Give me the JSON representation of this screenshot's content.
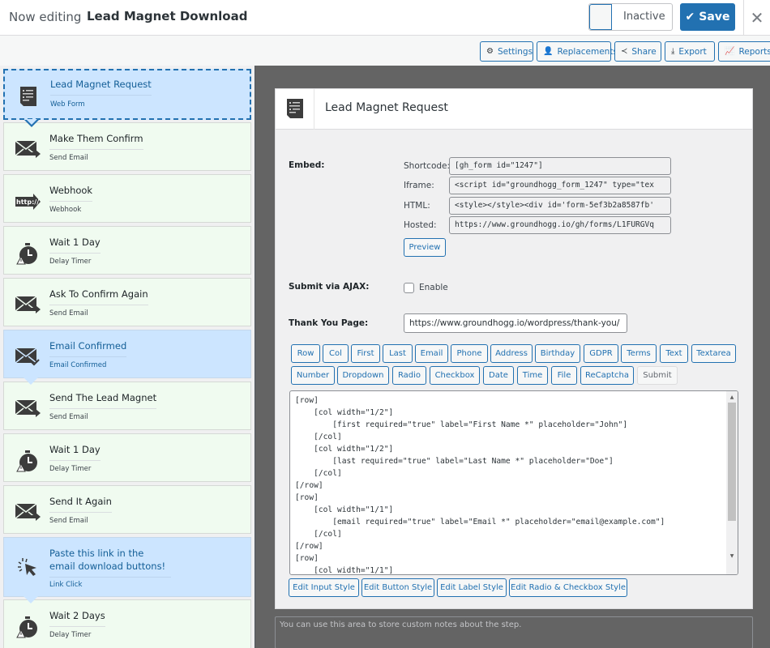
{
  "header": {
    "prefix": "Now editing",
    "funnel_title": "Lead Magnet Download",
    "status_toggle": "Inactive",
    "save_label": "Save"
  },
  "toolbar": {
    "settings": "Settings",
    "replacements": "Replacements",
    "share": "Share",
    "export": "Export",
    "reports": "Reports"
  },
  "steps": [
    {
      "name": "Lead Magnet Request",
      "type": "Web Form",
      "icon": "web-form-icon"
    },
    {
      "name": "Make Them Confirm",
      "type": "Send Email",
      "icon": "send-email-icon"
    },
    {
      "name": "Webhook",
      "type": "Webhook",
      "icon": "webhook-icon"
    },
    {
      "name": "Wait 1 Day",
      "type": "Delay Timer",
      "icon": "delay-timer-icon"
    },
    {
      "name": "Ask To Confirm Again",
      "type": "Send Email",
      "icon": "send-email-icon"
    },
    {
      "name": "Email Confirmed",
      "type": "Email Confirmed",
      "icon": "email-confirmed-icon"
    },
    {
      "name": "Send The Lead Magnet",
      "type": "Send Email",
      "icon": "send-email-icon"
    },
    {
      "name": "Wait 1 Day",
      "type": "Delay Timer",
      "icon": "delay-timer-icon"
    },
    {
      "name": "Send It Again",
      "type": "Send Email",
      "icon": "send-email-icon"
    },
    {
      "name": "Paste this link in the email download buttons!",
      "type": "Link Click",
      "icon": "link-click-icon"
    },
    {
      "name": "Wait 2 Days",
      "type": "Delay Timer",
      "icon": "delay-timer-icon"
    }
  ],
  "panel": {
    "title": "Lead Magnet Request",
    "embed_label": "Embed:",
    "embed": {
      "shortcode_label": "Shortcode:",
      "shortcode_value": "[gh_form id=\"1247\"]",
      "iframe_label": "Iframe:",
      "iframe_value": "<script id=\"groundhogg_form_1247\" type=\"tex",
      "html_label": "HTML:",
      "html_value": "<style></style><div id='form-5ef3b2a8587fb'",
      "hosted_label": "Hosted:",
      "hosted_value": "https://www.groundhogg.io/gh/forms/L1FURGVq",
      "preview_label": "Preview"
    },
    "ajax_label": "Submit via AJAX:",
    "ajax_checkbox_label": "Enable",
    "thank_you_label": "Thank You Page:",
    "thank_you_value": "https://www.groundhogg.io/wordpress/thank-you/",
    "field_buttons_row1": [
      "Row",
      "Col",
      "First",
      "Last",
      "Email",
      "Phone",
      "Address",
      "Birthday",
      "GDPR",
      "Terms",
      "Text",
      "Textarea"
    ],
    "field_buttons_row2": [
      "Number",
      "Dropdown",
      "Radio",
      "Checkbox",
      "Date",
      "Time",
      "File",
      "ReCaptcha",
      "Submit"
    ],
    "form_code": "[row]\n    [col width=\"1/2\"]\n        [first required=\"true\" label=\"First Name *\" placeholder=\"John\"]\n    [/col]\n    [col width=\"1/2\"]\n        [last required=\"true\" label=\"Last Name *\" placeholder=\"Doe\"]\n    [/col]\n[/row]\n[row]\n    [col width=\"1/1\"]\n        [email required=\"true\" label=\"Email *\" placeholder=\"email@example.com\"]\n    [/col]\n[/row]\n[row]\n    [col width=\"1/1\"]",
    "style_buttons": [
      "Edit Input Style",
      "Edit Button Style",
      "Edit Label Style",
      "Edit Radio & Checkbox Style"
    ]
  },
  "notes_placeholder": "You can use this area to store custom notes about the step.",
  "colors": {
    "primary": "#2271b1",
    "active_step": "#cce5ff",
    "step_bg": "#f0fbf0",
    "canvas": "#646464"
  }
}
